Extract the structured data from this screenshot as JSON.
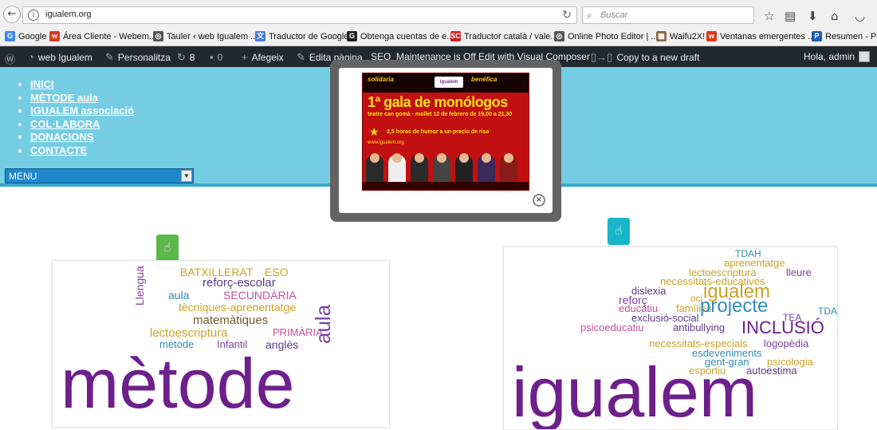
{
  "browser": {
    "url": "igualem.org",
    "search_placeholder": "Buscar",
    "bookmarks": [
      {
        "label": "Google",
        "icon": "G",
        "color": "#4285f4"
      },
      {
        "label": "Área Cliente - Webem...",
        "icon": "w",
        "color": "#d93a1f"
      },
      {
        "label": "Tauler ‹ web Igualem ...",
        "icon": "◎",
        "color": "#555555"
      },
      {
        "label": "Traductor de Google",
        "icon": "文",
        "color": "#4a7bd8"
      },
      {
        "label": "Obtenga cuentas de e...",
        "icon": "G",
        "color": "#222222"
      },
      {
        "label": "Traductor català / vale...",
        "icon": "SC",
        "color": "#cc2222"
      },
      {
        "label": "Online Photo Editor | ...",
        "icon": "◎",
        "color": "#555555"
      },
      {
        "label": "Waifu2X!",
        "icon": "▦",
        "color": "#8a6a4a"
      },
      {
        "label": "Ventanas emergentes ...",
        "icon": "w",
        "color": "#d93a1f"
      },
      {
        "label": "Resumen - Pay",
        "icon": "P",
        "color": "#1f5fb0"
      }
    ]
  },
  "wp_admin": {
    "site_name": "web Igualem",
    "customize": "Personalitza",
    "updates_count": "8",
    "comments_count": "0",
    "add_new": "Afegeix",
    "edit_page": "Edita pàgina",
    "seo": "SEO",
    "maintenance": "Maintenance is Off",
    "visual_composer": "Edit with Visual Composer",
    "copy_draft": "Copy to a new draft",
    "greeting": "Hola, admin"
  },
  "site_nav": {
    "items": [
      "INICI",
      "MÈTODE aula",
      "IGUALEM associació",
      "COL·LABORA",
      "DONACIONS",
      "CONTACTE"
    ],
    "menu_select": "MENU"
  },
  "popup": {
    "poster": {
      "solidaria": "solidaria",
      "benefica": "benéfica",
      "logo": "igualem",
      "title": "1ª gala de monólogos",
      "subtitle": "teatre can gomà · mollet 12 de febrero de 19,00 a 21,30",
      "humor": "2,5 horas de humor a un precio de risa",
      "url": "www.igualem.org"
    }
  },
  "cards": {
    "left_words": [
      {
        "t": "BATXILLERAT",
        "c": "#c9a227"
      },
      {
        "t": "ESO",
        "c": "#c9a227"
      },
      {
        "t": "Llengua",
        "c": "#7b3fa0"
      },
      {
        "t": "reforç-escolar",
        "c": "#5a3b8a"
      },
      {
        "t": "aula",
        "c": "#2f8db3"
      },
      {
        "t": "SECUNDÀRIA",
        "c": "#c04f9f"
      },
      {
        "t": "tècniques-aprenentatge",
        "c": "#c9a227"
      },
      {
        "t": "matemàtiques",
        "c": "#6b5a2a"
      },
      {
        "t": "lectoescriptura",
        "c": "#c9a227"
      },
      {
        "t": "PRIMÀRIA",
        "c": "#c04f9f"
      },
      {
        "t": "mètode",
        "c": "#2f8db3"
      },
      {
        "t": "Infantil",
        "c": "#7b3fa0"
      },
      {
        "t": "anglès",
        "c": "#5a3b8a"
      },
      {
        "t": "aula",
        "c": "#7b3fa0"
      },
      {
        "t": "mètode",
        "c": "#6d1f8c"
      }
    ],
    "right_words": [
      {
        "t": "TDAH",
        "c": "#2f8db3"
      },
      {
        "t": "aprenentatge",
        "c": "#c9a227"
      },
      {
        "t": "lectoescriptura",
        "c": "#c9a227"
      },
      {
        "t": "lleure",
        "c": "#7b3fa0"
      },
      {
        "t": "necessitats-educatives",
        "c": "#c9a227"
      },
      {
        "t": "dislexia",
        "c": "#5a3b8a"
      },
      {
        "t": "reforç",
        "c": "#7b3fa0"
      },
      {
        "t": "oci",
        "c": "#c9a227"
      },
      {
        "t": "igualem",
        "c": "#c9a227"
      },
      {
        "t": "educatiu",
        "c": "#c04f9f"
      },
      {
        "t": "famílies",
        "c": "#c9a227"
      },
      {
        "t": "projecte",
        "c": "#2f8db3"
      },
      {
        "t": "TDA",
        "c": "#2f8db3"
      },
      {
        "t": "exclusió-social",
        "c": "#5a3b8a"
      },
      {
        "t": "TEA",
        "c": "#7b3fa0"
      },
      {
        "t": "psicoeducatiu",
        "c": "#c04f9f"
      },
      {
        "t": "antibullying",
        "c": "#5a3b8a"
      },
      {
        "t": "INCLUSIÓ",
        "c": "#6d1f8c"
      },
      {
        "t": "necessitats-especials",
        "c": "#c9a227"
      },
      {
        "t": "logopèdia",
        "c": "#7b3fa0"
      },
      {
        "t": "esdeveniments",
        "c": "#2f8db3"
      },
      {
        "t": "gent-gran",
        "c": "#2f8db3"
      },
      {
        "t": "psicologia",
        "c": "#c9a227"
      },
      {
        "t": "esportiu",
        "c": "#c9a227"
      },
      {
        "t": "autoestima",
        "c": "#5a3b8a"
      },
      {
        "t": "igualem",
        "c": "#6d1f8c"
      }
    ]
  },
  "colors": {
    "header_bg": "#75cde4",
    "wp_bar": "#23282d",
    "hand_green": "#5cb84a",
    "hand_teal": "#19b5c9"
  }
}
